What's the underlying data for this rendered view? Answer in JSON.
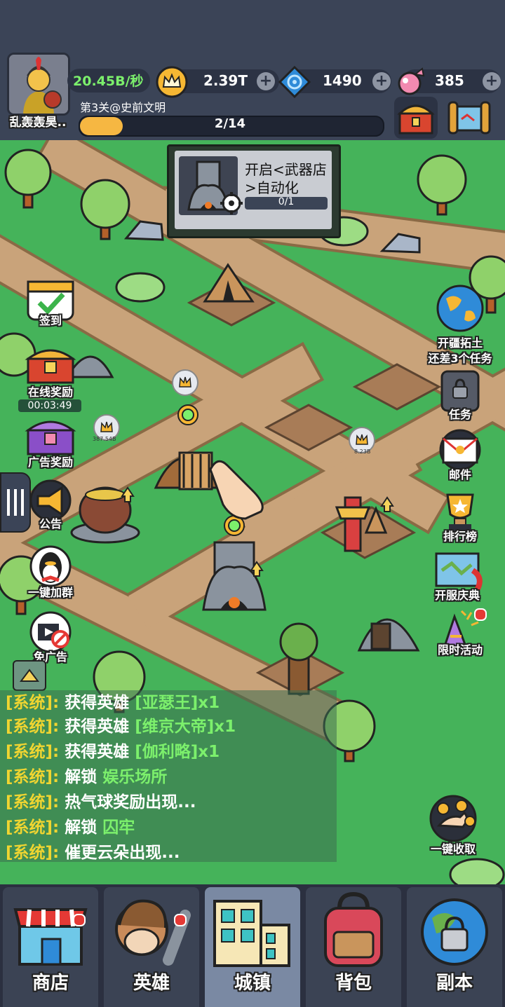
{
  "player": {
    "name": "乱轰轰昊..",
    "income": "20.45B/秒",
    "stage": "第3关@史前文明"
  },
  "resources": {
    "crown": "2.39T",
    "gem": "1490",
    "candy": "385"
  },
  "progress": {
    "text": "2/14",
    "fraction": 0.143
  },
  "task_panel": {
    "title": "开启<武器店>自动化",
    "progress": "0/1"
  },
  "left_buttons": {
    "signin": "签到",
    "online_reward": "在线奖励",
    "timer": "00:03:49",
    "ad_reward": "广告奖励",
    "notice": "公告",
    "join_group": "一键加群",
    "no_ads": "免广告"
  },
  "right_buttons": {
    "expand": "开疆拓土",
    "expand_sub": "还差3个任务",
    "tasks": "任务",
    "mail": "邮件",
    "rank": "排行榜",
    "server_celebration": "开服庆典",
    "limited_event": "限时活动",
    "collect_all": "一键收取"
  },
  "chat": {
    "sys_tag": "[系统]:",
    "lines": [
      {
        "prefix": "获得英雄 ",
        "highlight": "[亚瑟王]x1"
      },
      {
        "prefix": "获得英雄 ",
        "highlight": "[维京大帝]x1"
      },
      {
        "prefix": "获得英雄 ",
        "highlight": "[伽利略]x1"
      },
      {
        "prefix": "解锁 ",
        "highlight": "娱乐场所"
      },
      {
        "prefix": "热气球奖励出现...",
        "highlight": ""
      },
      {
        "prefix": "解锁 ",
        "highlight": "囚牢"
      },
      {
        "prefix": "催更云朵出现...",
        "highlight": ""
      }
    ]
  },
  "map_labels": {
    "bubble1": "387.54B",
    "bubble2": "8.23B"
  },
  "tabs": [
    "商店",
    "英雄",
    "城镇",
    "背包",
    "副本"
  ],
  "colors": {
    "grass": "#45b35a",
    "road": "#c9a37a",
    "accent": "#f6b742",
    "highlight": "#7cf06c",
    "system": "#f0d531"
  }
}
